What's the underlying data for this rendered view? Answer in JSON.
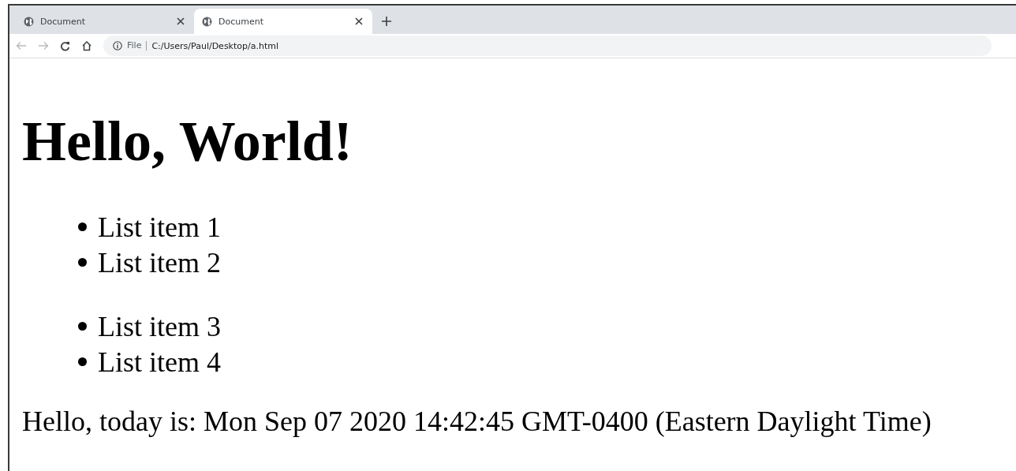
{
  "tabs": [
    {
      "title": "Document",
      "selected": false
    },
    {
      "title": "Document",
      "selected": true
    }
  ],
  "address_bar": {
    "scheme": "File",
    "url": "C:/Users/Paul/Desktop/a.html"
  },
  "page": {
    "heading": "Hello, World!",
    "lists": [
      {
        "items": [
          "List item 1",
          "List item 2"
        ]
      },
      {
        "items": [
          "List item 3",
          "List item 4"
        ]
      }
    ],
    "paragraph": "Hello, today is: Mon Sep 07 2020 14:42:45 GMT-0400 (Eastern Daylight Time)"
  }
}
